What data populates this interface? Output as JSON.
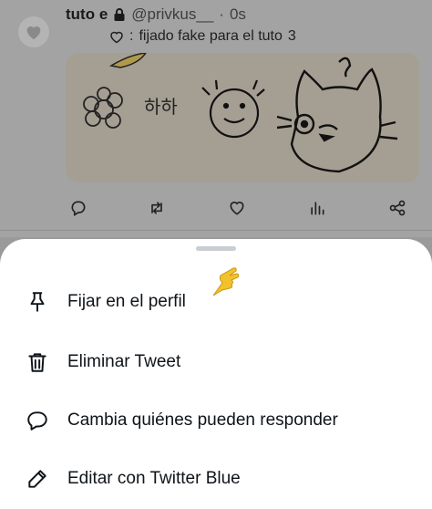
{
  "tweet": {
    "display_name": "tuto e",
    "handle": "@privkus__",
    "separator": "·",
    "time": "0s",
    "text_prefix": ":",
    "text": "fijado fake para el tuto",
    "text_suffix": "3",
    "media": {
      "doodle_text": "하하"
    },
    "actions": [
      "reply-icon",
      "retweet-icon",
      "like-icon",
      "analytics-icon",
      "share-icon"
    ]
  },
  "sheet": {
    "items": [
      {
        "icon": "pin-icon",
        "label": "Fijar en el perfil"
      },
      {
        "icon": "trash-icon",
        "label": "Eliminar Tweet"
      },
      {
        "icon": "reply-settings-icon",
        "label": "Cambia quiénes pueden responder"
      },
      {
        "icon": "edit-icon",
        "label": "Editar con Twitter Blue"
      }
    ]
  },
  "colors": {
    "overlay": "#a3a3a3",
    "sheet": "#ffffff",
    "text": "#0f1419",
    "grabber": "#c9ced3"
  }
}
